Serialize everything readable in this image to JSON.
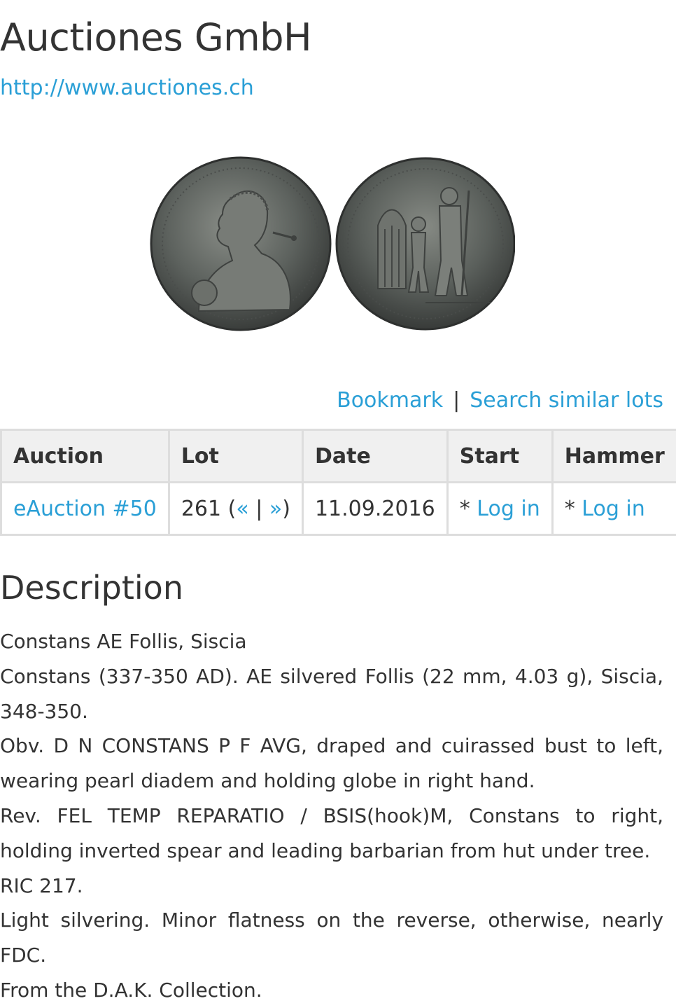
{
  "header": {
    "title": "Auctiones GmbH",
    "url": "http://www.auctiones.ch"
  },
  "image": {
    "description_icon": "coin-obverse-reverse-photo"
  },
  "actions": {
    "bookmark": "Bookmark",
    "separator": "|",
    "search_similar": "Search similar lots"
  },
  "table": {
    "headers": [
      "Auction",
      "Lot",
      "Date",
      "Start",
      "Hammer"
    ],
    "row": {
      "auction": "eAuction #50",
      "lot_number": "261 (",
      "prev": "«",
      "pipe": " | ",
      "next": "»",
      "close": ")",
      "date": "11.09.2016",
      "start_prefix": "* ",
      "start_link": "Log in",
      "hammer_prefix": "* ",
      "hammer_link": "Log in"
    }
  },
  "description": {
    "heading": "Description",
    "lines": [
      "Constans AE Follis, Siscia",
      "Constans (337-350 AD). AE silvered Follis (22 mm, 4.03 g), Siscia, 348-350.",
      "Obv. D N CONSTANS P F AVG, draped and cuirassed bust to left, wearing pearl diadem and holding globe in right hand.",
      "Rev. FEL TEMP REPARATIO / BSIS(hook)M, Constans to right, holding inverted spear and leading barbarian from hut under tree.",
      "RIC 217.",
      "Light silvering. Minor flatness on the reverse, otherwise, nearly FDC.",
      "From the D.A.K. Collection."
    ]
  },
  "colors": {
    "link": "#2a9fd6",
    "text": "#333333",
    "table_header_bg": "#f0f0f0",
    "table_border": "#dddddd"
  }
}
